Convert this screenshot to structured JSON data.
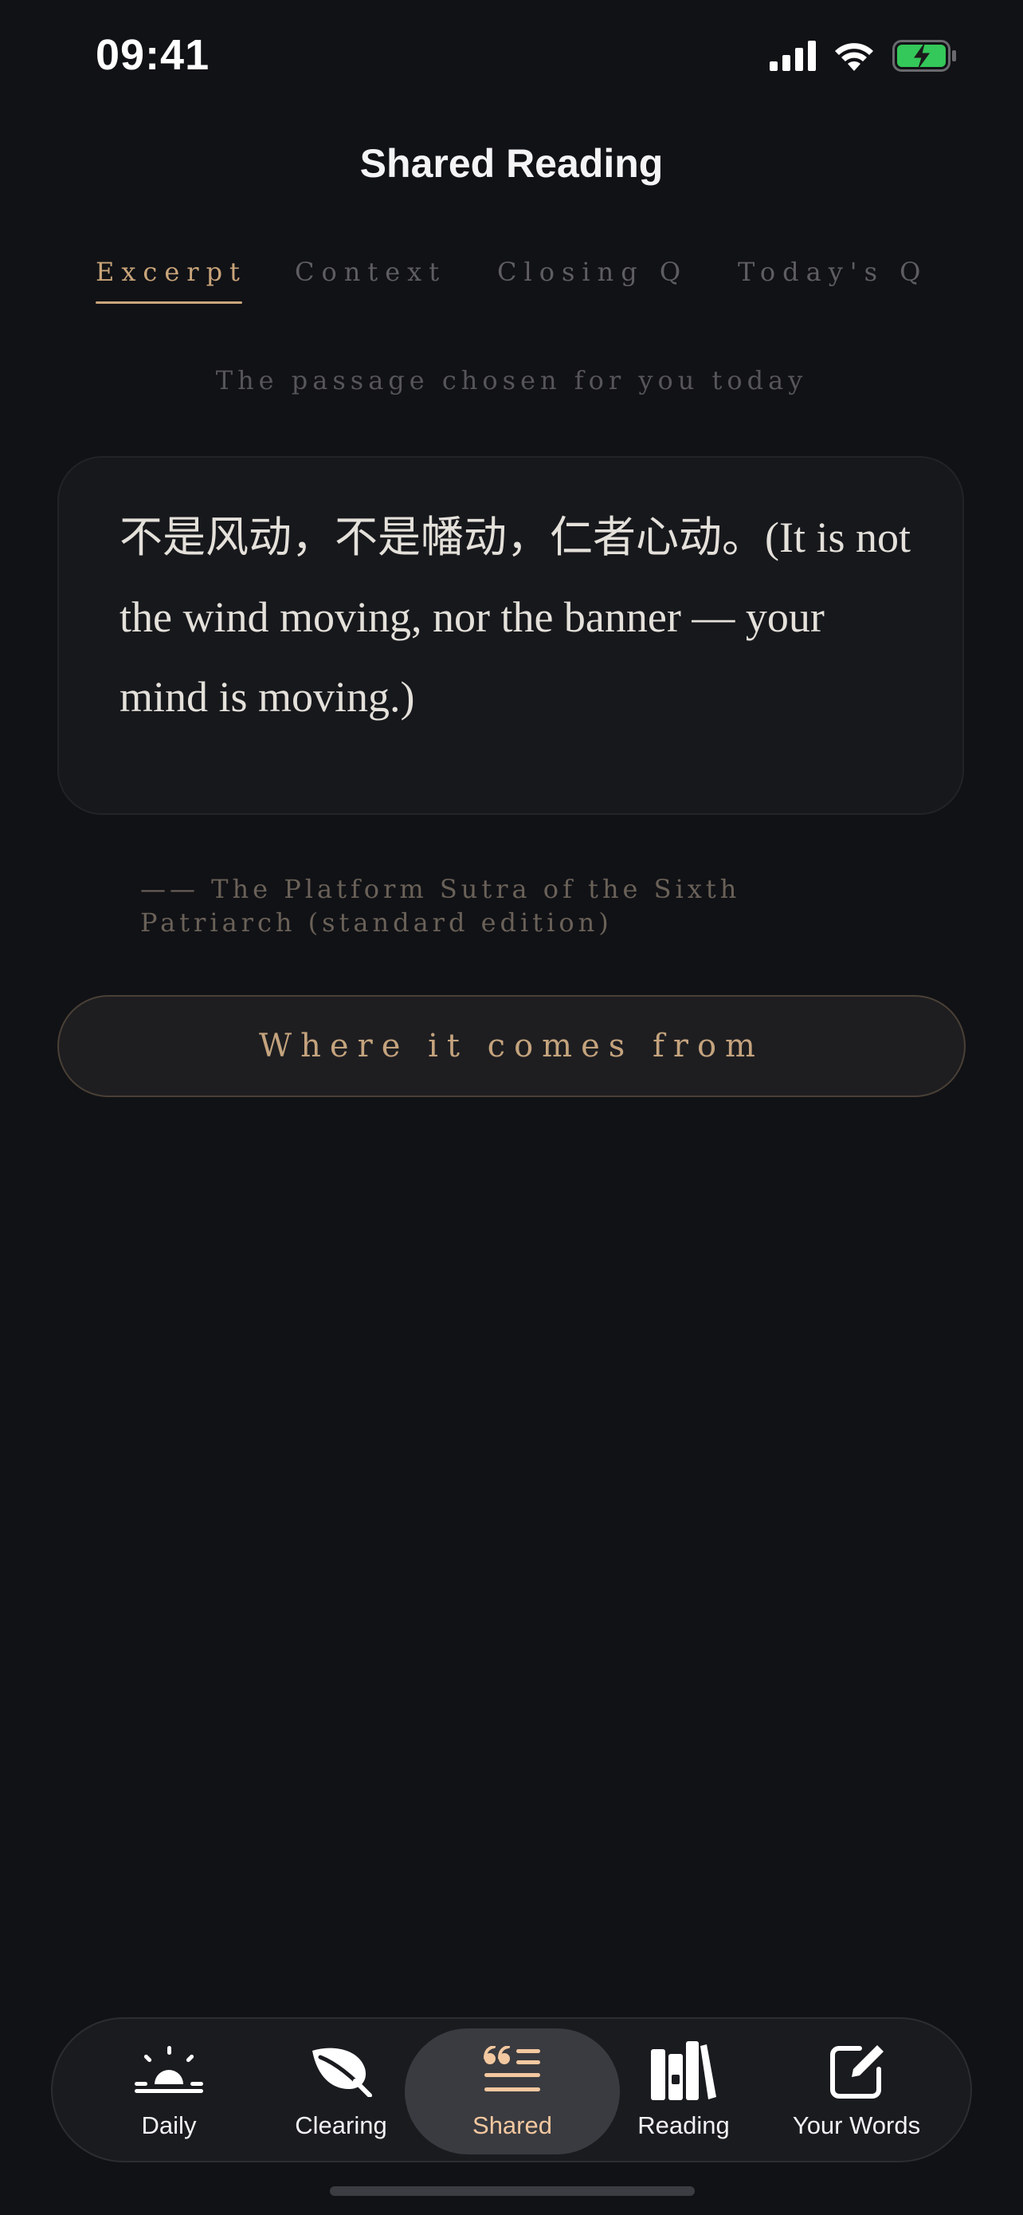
{
  "status_bar": {
    "time": "09:41",
    "icons": [
      "cellular-signal-icon",
      "wifi-icon",
      "battery-charging-icon"
    ]
  },
  "header": {
    "title": "Shared Reading"
  },
  "tabs": [
    {
      "label": "Excerpt",
      "active": true
    },
    {
      "label": "Context",
      "active": false
    },
    {
      "label": "Closing Q",
      "active": false
    },
    {
      "label": "Today's Q",
      "active": false
    }
  ],
  "subtitle": "The passage chosen for you today",
  "quote": {
    "text": "不是风动，不是幡动，仁者心动。(It is not the wind moving, nor the banner — your mind is moving.)",
    "source": "—— The Platform Sutra of the Sixth Patriarch (standard edition)"
  },
  "origin_button": {
    "label": "Where it comes from"
  },
  "tabbar": [
    {
      "label": "Daily",
      "icon": "sunrise-icon",
      "active": false
    },
    {
      "label": "Clearing",
      "icon": "leaf-icon",
      "active": false
    },
    {
      "label": "Shared",
      "icon": "quote-icon",
      "active": true
    },
    {
      "label": "Reading",
      "icon": "books-icon",
      "active": false
    },
    {
      "label": "Your Words",
      "icon": "compose-icon",
      "active": false
    }
  ],
  "colors": {
    "background": "#111216",
    "accent": "#c9a57a",
    "active_tab_label": "#f3c8a0",
    "battery_green": "#34c759"
  }
}
